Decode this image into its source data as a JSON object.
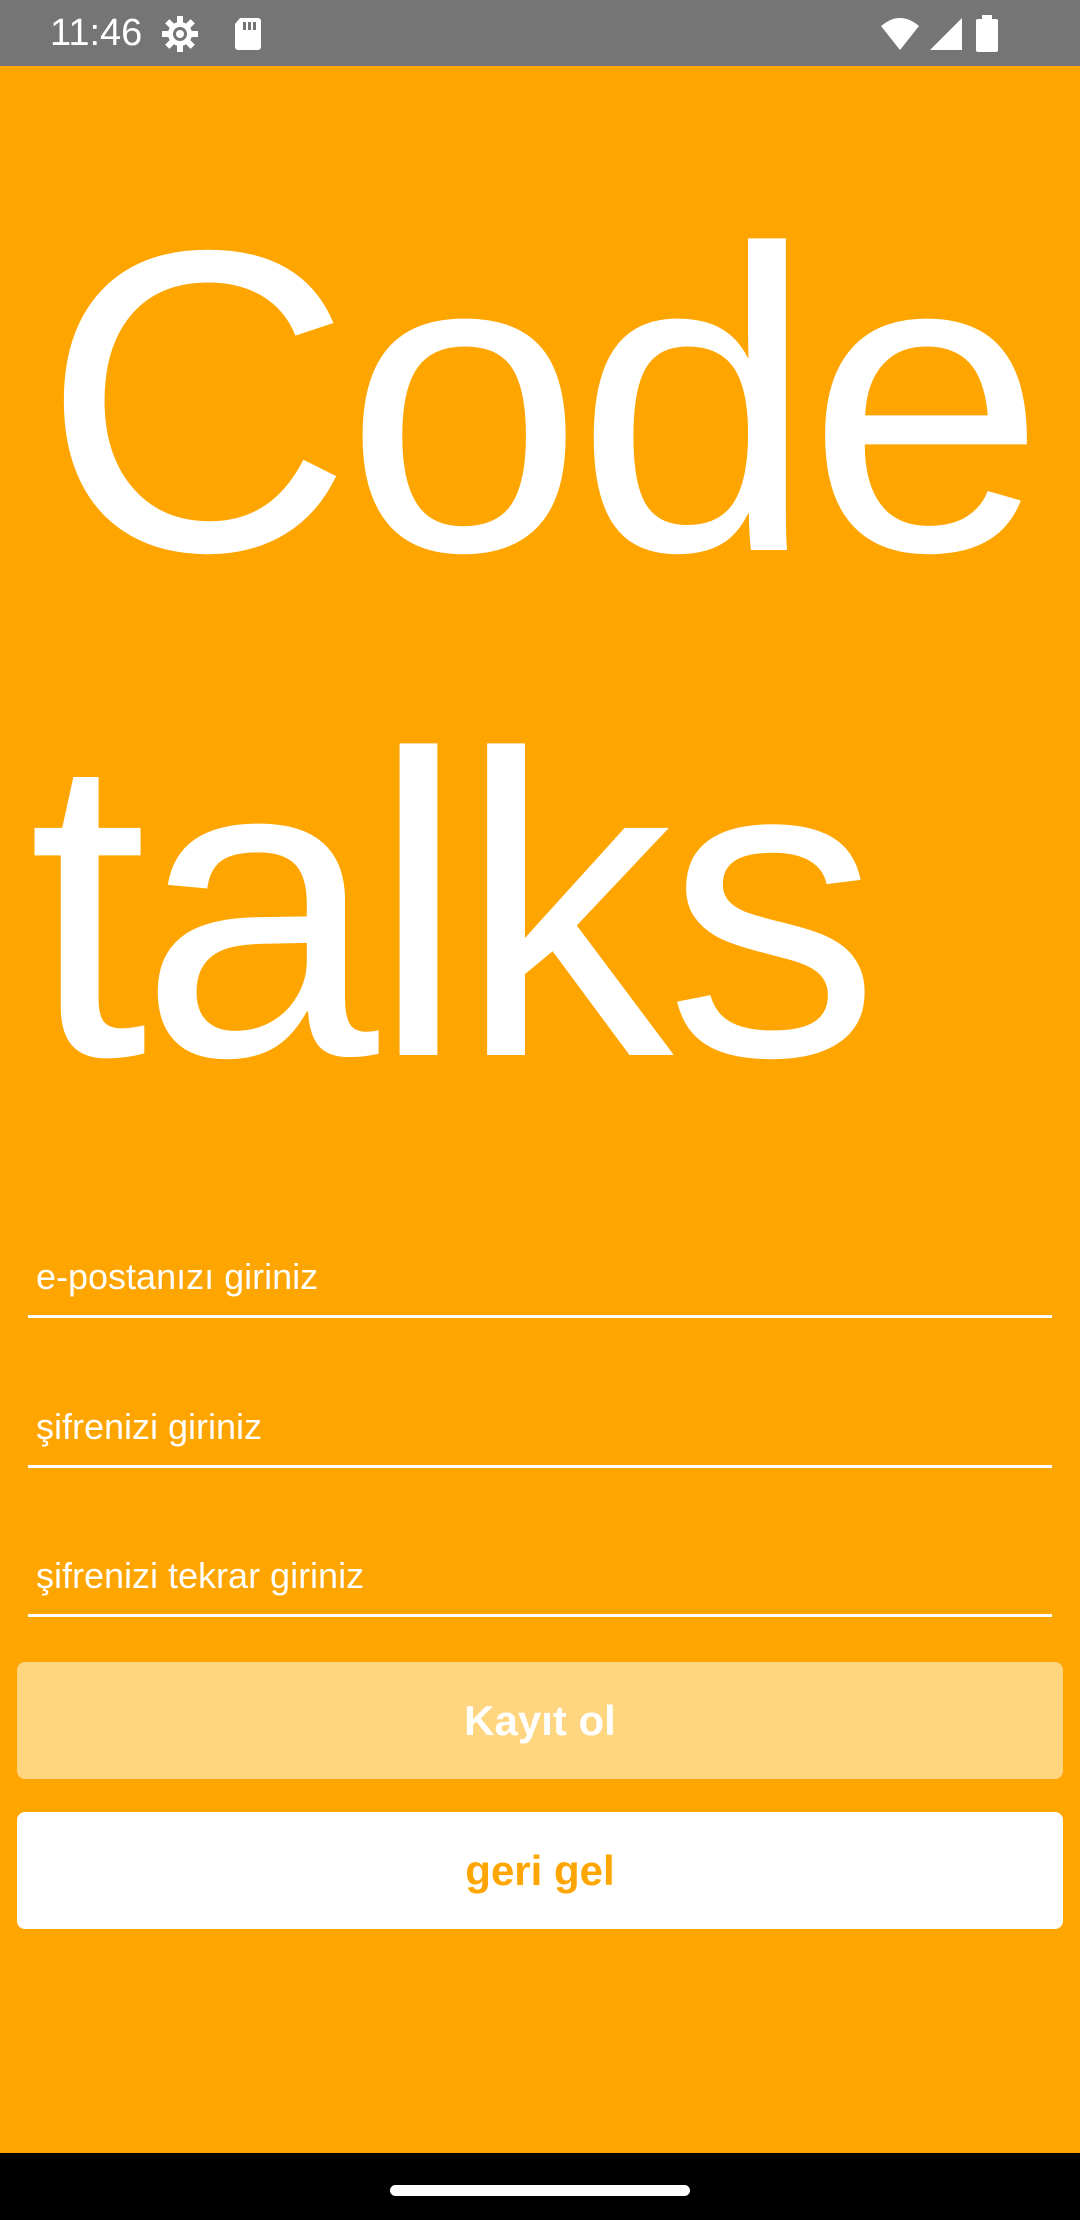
{
  "status_bar": {
    "time": "11:46",
    "icons": [
      "settings-icon",
      "sd-card-icon",
      "wifi-icon",
      "signal-icon",
      "battery-icon"
    ]
  },
  "title": {
    "line1": "Code",
    "line2": "talks"
  },
  "form": {
    "email_placeholder": "e-postanızı giriniz",
    "password_placeholder": "şifrenizi giriniz",
    "password_repeat_placeholder": "şifrenizi tekrar giriniz"
  },
  "buttons": {
    "register_label": "Kayıt ol",
    "back_label": "geri gel"
  },
  "colors": {
    "background": "#FFA500",
    "register_button": "#FFD580",
    "back_button": "#FFFFFF",
    "back_button_text": "#FFA500",
    "status_bar": "#757575",
    "nav_bar": "#000000"
  }
}
